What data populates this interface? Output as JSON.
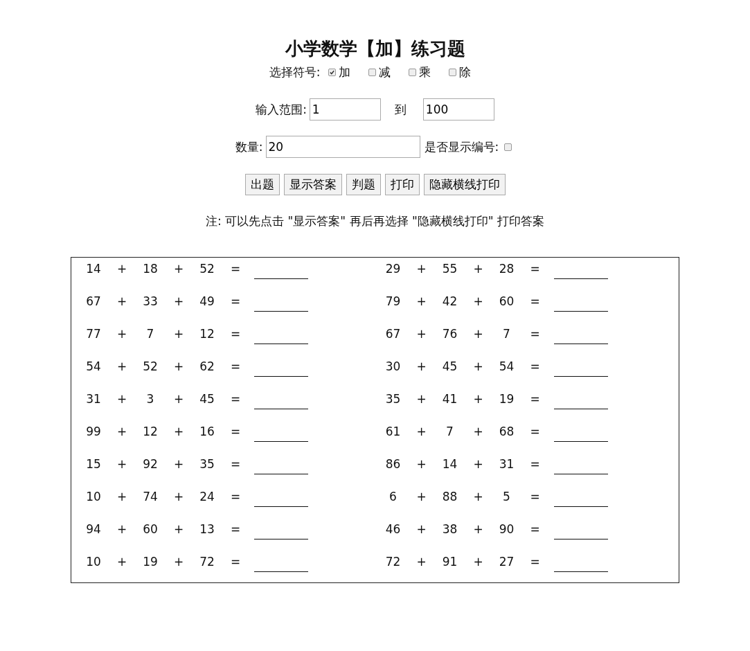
{
  "title": "小学数学【加】练习题",
  "operators": {
    "label": "选择符号:",
    "options": [
      {
        "label": "加",
        "checked": true
      },
      {
        "label": "减",
        "checked": false
      },
      {
        "label": "乘",
        "checked": false
      },
      {
        "label": "除",
        "checked": false
      }
    ]
  },
  "range": {
    "label": "输入范围:",
    "from": "1",
    "to_label": "到",
    "to": "100"
  },
  "count": {
    "label": "数量:",
    "value": "20",
    "numbering_label": "是否显示编号:",
    "numbering": false
  },
  "buttons": [
    "出题",
    "显示答案",
    "判题",
    "打印",
    "隐藏横线打印"
  ],
  "note": "注: 可以先点击 \"显示答案\" 再后再选择 \"隐藏横线打印\" 打印答案",
  "problems": [
    [
      "14",
      "+",
      "18",
      "+",
      "52",
      "="
    ],
    [
      "29",
      "+",
      "55",
      "+",
      "28",
      "="
    ],
    [
      "67",
      "+",
      "33",
      "+",
      "49",
      "="
    ],
    [
      "79",
      "+",
      "42",
      "+",
      "60",
      "="
    ],
    [
      "77",
      "+",
      "7",
      "+",
      "12",
      "="
    ],
    [
      "67",
      "+",
      "76",
      "+",
      "7",
      "="
    ],
    [
      "54",
      "+",
      "52",
      "+",
      "62",
      "="
    ],
    [
      "30",
      "+",
      "45",
      "+",
      "54",
      "="
    ],
    [
      "31",
      "+",
      "3",
      "+",
      "45",
      "="
    ],
    [
      "35",
      "+",
      "41",
      "+",
      "19",
      "="
    ],
    [
      "99",
      "+",
      "12",
      "+",
      "16",
      "="
    ],
    [
      "61",
      "+",
      "7",
      "+",
      "68",
      "="
    ],
    [
      "15",
      "+",
      "92",
      "+",
      "35",
      "="
    ],
    [
      "86",
      "+",
      "14",
      "+",
      "31",
      "="
    ],
    [
      "10",
      "+",
      "74",
      "+",
      "24",
      "="
    ],
    [
      "6",
      "+",
      "88",
      "+",
      "5",
      "="
    ],
    [
      "94",
      "+",
      "60",
      "+",
      "13",
      "="
    ],
    [
      "46",
      "+",
      "38",
      "+",
      "90",
      "="
    ],
    [
      "10",
      "+",
      "19",
      "+",
      "72",
      "="
    ],
    [
      "72",
      "+",
      "91",
      "+",
      "27",
      "="
    ]
  ]
}
